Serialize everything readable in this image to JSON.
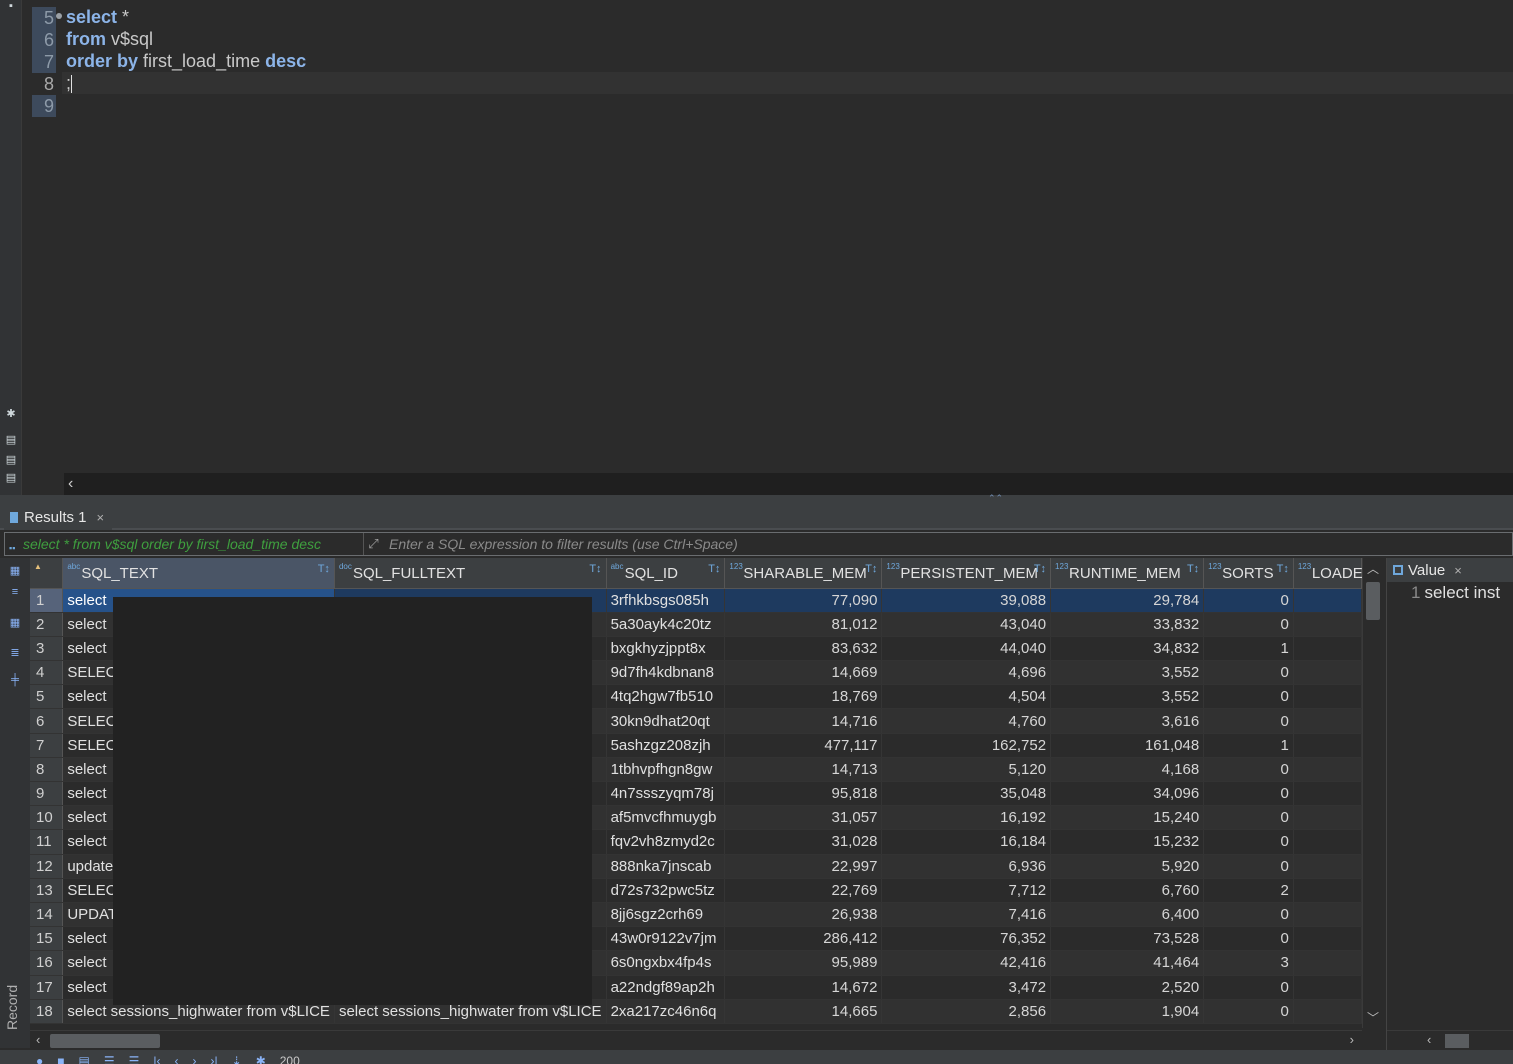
{
  "editor": {
    "lines": [
      {
        "no": "5",
        "tokens": [
          {
            "t": "select",
            "c": "kw"
          },
          {
            "t": " *",
            "c": "tx"
          }
        ]
      },
      {
        "no": "6",
        "tokens": [
          {
            "t": "from",
            "c": "kw"
          },
          {
            "t": " v$sql",
            "c": "tx"
          }
        ]
      },
      {
        "no": "7",
        "tokens": [
          {
            "t": "order by",
            "c": "kw"
          },
          {
            "t": " first_load_time ",
            "c": "tx"
          },
          {
            "t": "desc",
            "c": "kw"
          }
        ]
      },
      {
        "no": "8",
        "tokens": [
          {
            "t": ";",
            "c": "tx"
          }
        ]
      },
      {
        "no": "9",
        "tokens": []
      }
    ]
  },
  "results_tab": {
    "label": "Results 1",
    "close": "×"
  },
  "filter": {
    "query_echo": "select * from v$sql order by first_load_time desc",
    "placeholder": "Enter a SQL expression to filter results (use Ctrl+Space)"
  },
  "grid": {
    "columns": [
      {
        "label": "SQL_TEXT",
        "type": "abc",
        "align": "left",
        "width": 265,
        "selected": true
      },
      {
        "label": "SQL_FULLTEXT",
        "type": "doc",
        "align": "left",
        "width": 264
      },
      {
        "label": "SQL_ID",
        "type": "abc",
        "align": "left",
        "width": 119
      },
      {
        "label": "SHARABLE_MEM",
        "type": "123",
        "align": "right",
        "width": 160
      },
      {
        "label": "PERSISTENT_MEM",
        "type": "123",
        "align": "right",
        "width": 172
      },
      {
        "label": "RUNTIME_MEM",
        "type": "123",
        "align": "right",
        "width": 156
      },
      {
        "label": "SORTS",
        "type": "123",
        "align": "right",
        "width": 92
      },
      {
        "label": "LOADE",
        "type": "123",
        "align": "right",
        "width": 70
      }
    ],
    "rows": [
      {
        "n": "1",
        "cells": [
          "select",
          "",
          "3rfhkbsgs085h",
          "77,090",
          "39,088",
          "29,784",
          "0",
          ""
        ]
      },
      {
        "n": "2",
        "cells": [
          "select",
          "",
          "5a30ayk4c20tz",
          "81,012",
          "43,040",
          "33,832",
          "0",
          ""
        ]
      },
      {
        "n": "3",
        "cells": [
          "select",
          "",
          "bxgkhyzjppt8x",
          "83,632",
          "44,040",
          "34,832",
          "1",
          ""
        ]
      },
      {
        "n": "4",
        "cells": [
          "SELECT",
          "",
          "9d7fh4kdbnan8",
          "14,669",
          "4,696",
          "3,552",
          "0",
          ""
        ]
      },
      {
        "n": "5",
        "cells": [
          "select",
          "",
          "4tq2hgw7fb510",
          "18,769",
          "4,504",
          "3,552",
          "0",
          ""
        ]
      },
      {
        "n": "6",
        "cells": [
          "SELECT",
          "",
          "30kn9dhat20qt",
          "14,716",
          "4,760",
          "3,616",
          "0",
          ""
        ]
      },
      {
        "n": "7",
        "cells": [
          "SELECT",
          "",
          "5ashzgz208zjh",
          "477,117",
          "162,752",
          "161,048",
          "1",
          ""
        ]
      },
      {
        "n": "8",
        "cells": [
          "select",
          "",
          "1tbhvpfhgn8gw",
          "14,713",
          "5,120",
          "4,168",
          "0",
          ""
        ]
      },
      {
        "n": "9",
        "cells": [
          "select",
          "",
          "4n7ssszyqm78j",
          "95,818",
          "35,048",
          "34,096",
          "0",
          ""
        ]
      },
      {
        "n": "10",
        "cells": [
          "select",
          "",
          "af5mvcfhmuygb",
          "31,057",
          "16,192",
          "15,240",
          "0",
          ""
        ]
      },
      {
        "n": "11",
        "cells": [
          "select",
          "",
          "fqv2vh8zmyd2c",
          "31,028",
          "16,184",
          "15,232",
          "0",
          ""
        ]
      },
      {
        "n": "12",
        "cells": [
          "update",
          "",
          "888nka7jnscab",
          "22,997",
          "6,936",
          "5,920",
          "0",
          ""
        ]
      },
      {
        "n": "13",
        "cells": [
          "SELECT",
          "",
          "d72s732pwc5tz",
          "22,769",
          "7,712",
          "6,760",
          "2",
          ""
        ]
      },
      {
        "n": "14",
        "cells": [
          "UPDAT",
          "",
          "8jj6sgz2crh69",
          "26,938",
          "7,416",
          "6,400",
          "0",
          ""
        ]
      },
      {
        "n": "15",
        "cells": [
          "select",
          "",
          "43w0r9122v7jm",
          "286,412",
          "76,352",
          "73,528",
          "0",
          ""
        ]
      },
      {
        "n": "16",
        "cells": [
          "select",
          "",
          "6s0ngxbx4fp4s",
          "95,989",
          "42,416",
          "41,464",
          "3",
          ""
        ]
      },
      {
        "n": "17",
        "cells": [
          "select",
          "",
          "a22ndgf89ap2h",
          "14,672",
          "3,472",
          "2,520",
          "0",
          ""
        ]
      },
      {
        "n": "18",
        "cells": [
          "select sessions_highwater from v$LICE",
          "select sessions_highwater from v$LICE",
          "2xa217zc46n6q",
          "14,665",
          "2,856",
          "1,904",
          "0",
          ""
        ]
      }
    ]
  },
  "value_panel": {
    "title": "Value",
    "close": "×",
    "line_no": "1",
    "content": "select inst"
  },
  "side": {
    "record_label": "Record"
  },
  "status": {
    "rows_fetched": "200"
  },
  "colors": {
    "keyword": "#8cb4e8",
    "selection": "#1e3a5f",
    "accent": "#6fa8dc",
    "query_echo": "#3f9f3f"
  }
}
